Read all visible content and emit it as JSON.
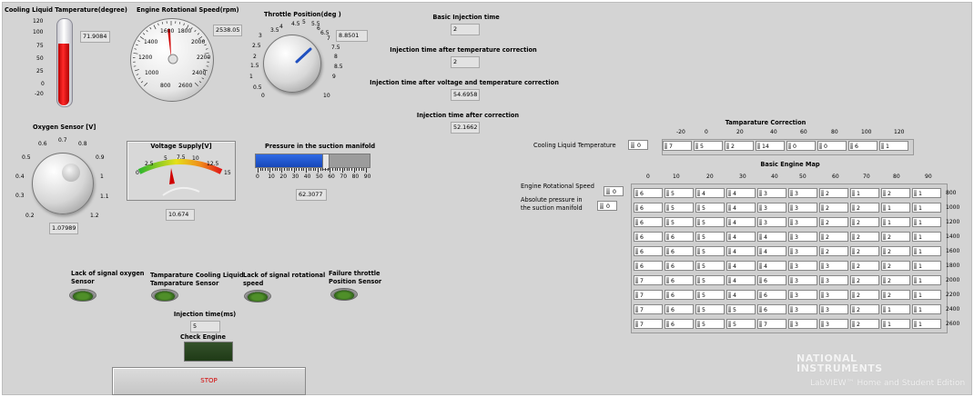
{
  "temperature": {
    "label": "Cooling Liquid Tamperature(degree)",
    "value": "71.9084",
    "scale": [
      "120",
      "100",
      "75",
      "50",
      "25",
      "0",
      "-20"
    ]
  },
  "rpm": {
    "label": "Engine Rotational Speed(rpm)",
    "value": "2538.05",
    "scale": [
      "1600",
      "1800",
      "1400",
      "2000",
      "1200",
      "2200",
      "1000",
      "2400",
      "800",
      "2600"
    ]
  },
  "throttle": {
    "label": "Throttle Position(deg )",
    "value": "8.8501",
    "scale": [
      "3.5",
      "4",
      "4.5",
      "5",
      "5.5",
      "6",
      "6.5",
      "7",
      "3",
      "2.5",
      "7.5",
      "2",
      "8",
      "1.5",
      "8.5",
      "1",
      "9",
      "0.5",
      "0",
      "10"
    ]
  },
  "injection": {
    "basic_label": "Basic Injection time",
    "basic_value": "2",
    "temp_corr_label": "Injection time after temperature correction",
    "temp_corr_value": "2",
    "volt_temp_label": "Injection time after voltage and temperature correction",
    "volt_temp_value": "54.6958",
    "after_corr_label": "Injection time after correction",
    "after_corr_value": "52.1662"
  },
  "oxygen": {
    "label": "Oxygen Sensor [V]",
    "value": "1.07989",
    "scale": [
      "0.7",
      "0.6",
      "0.8",
      "0.5",
      "0.9",
      "0.4",
      "1",
      "0.3",
      "1.1",
      "0.2",
      "1.2"
    ]
  },
  "voltage": {
    "label": "Voltage Supply[V]",
    "value": "10.674",
    "scale": [
      "0",
      "2.5",
      "5",
      "7.5",
      "10",
      "12.5",
      "15"
    ]
  },
  "pressure": {
    "label": "Pressure in the suction manifold",
    "value": "62.3077",
    "fraction": 0.62,
    "scale": [
      "0",
      "10",
      "20",
      "30",
      "40",
      "50",
      "60",
      "70",
      "80",
      "90"
    ]
  },
  "temp_correction": {
    "title": "Tamparature Correction",
    "row_label": "Cooling Liquid Temperature",
    "index": "0",
    "headers": [
      "-20",
      "0",
      "20",
      "40",
      "60",
      "80",
      "100",
      "120"
    ],
    "values": [
      "7",
      "5",
      "2",
      "14",
      "0",
      "0",
      "6",
      "1"
    ]
  },
  "engine_map": {
    "title": "Basic Engine Map",
    "speed_label": "Engine Rotational Speed",
    "pressure_label_1": "Absolute pressure in",
    "pressure_label_2": "the suction manifold",
    "speed_index": "0",
    "pressure_index": "0",
    "col_headers": [
      "0",
      "10",
      "20",
      "30",
      "40",
      "50",
      "60",
      "70",
      "80",
      "90"
    ],
    "row_headers": [
      "800",
      "1000",
      "1200",
      "1400",
      "1600",
      "1800",
      "2000",
      "2200",
      "2400",
      "2600"
    ],
    "rows": [
      [
        "6",
        "5",
        "4",
        "4",
        "3",
        "3",
        "2",
        "1",
        "2",
        "1"
      ],
      [
        "6",
        "5",
        "5",
        "4",
        "3",
        "3",
        "2",
        "2",
        "1",
        "1"
      ],
      [
        "6",
        "5",
        "5",
        "4",
        "3",
        "3",
        "2",
        "2",
        "1",
        "1"
      ],
      [
        "6",
        "6",
        "5",
        "4",
        "4",
        "3",
        "2",
        "2",
        "2",
        "1"
      ],
      [
        "6",
        "6",
        "5",
        "4",
        "4",
        "3",
        "2",
        "2",
        "2",
        "1"
      ],
      [
        "6",
        "6",
        "5",
        "4",
        "4",
        "3",
        "3",
        "2",
        "2",
        "1"
      ],
      [
        "7",
        "6",
        "5",
        "4",
        "6",
        "3",
        "3",
        "2",
        "2",
        "1"
      ],
      [
        "7",
        "6",
        "5",
        "4",
        "6",
        "3",
        "3",
        "2",
        "2",
        "1"
      ],
      [
        "7",
        "6",
        "5",
        "5",
        "6",
        "3",
        "3",
        "2",
        "1",
        "1"
      ],
      [
        "7",
        "6",
        "5",
        "5",
        "7",
        "3",
        "3",
        "2",
        "1",
        "1"
      ]
    ]
  },
  "leds": {
    "oxygen_1": "Lack of signal oxygen",
    "oxygen_2": "Sensor",
    "temp_1": "Tamparature Cooling Liquid",
    "temp_2": "Tamparature Sensor",
    "rot_1": "Lack of signal rotational",
    "rot_2": "speed",
    "thr_1": "Failure throttle",
    "thr_2": "Position Sensor"
  },
  "injection_ms": {
    "label": "Injection time(ms)",
    "value": "5"
  },
  "check_engine": {
    "label": "Check Engine"
  },
  "stop_label": "STOP",
  "branding": {
    "line1": "NATIONAL",
    "line2": "INSTRUMENTS",
    "line3": "LabVIEW™ Home and Student Edition"
  },
  "colors": {
    "background": "#d4d4d4",
    "thermo_fill": "#e00000",
    "needle": "#d00000",
    "throttle_needle": "#2050c0",
    "pressure_fill": "#1e5bd6",
    "stop_text": "#d40000"
  }
}
